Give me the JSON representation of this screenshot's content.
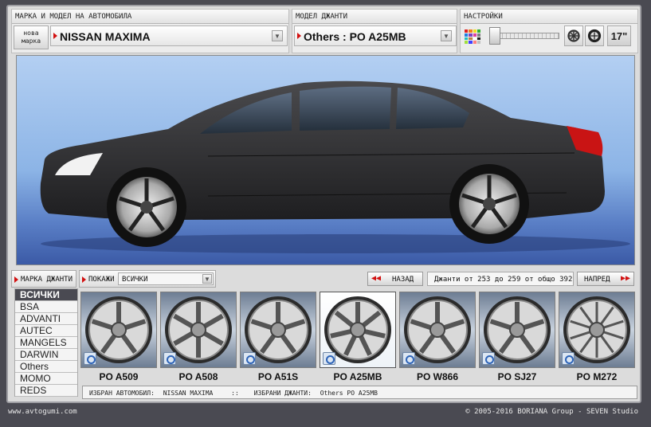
{
  "header": {
    "car_panel_title": "МАРКА И МОДЕЛ НА АВТОМОБИЛА",
    "new_brand_line1": "нова",
    "new_brand_line2": "марка",
    "car_selected": "NISSAN MAXIMA",
    "rims_panel_title": "МОДЕЛ ДЖАНТИ",
    "rim_selected": "Others : PO A25MB",
    "settings_title": "НАСТРОЙКИ",
    "rim_size": "17\""
  },
  "colors": {
    "accent_red": "#d21010",
    "palette": [
      "#e02020",
      "#f08020",
      "#f0e020",
      "#30b030",
      "#2080e0",
      "#8040c0",
      "#e040a0",
      "#808080",
      "#20c0c0",
      "#c08040",
      "#ffffff",
      "#202020",
      "#a0e040",
      "#4040ff",
      "#ff8080",
      "#c0c0c0"
    ]
  },
  "filters": {
    "brand_rims_label": "МАРКА ДЖАНТИ",
    "show_label": "ПОКАЖИ",
    "show_value": "ВСИЧКИ",
    "back_label": "НАЗАД",
    "range_info": "Джанти от 253 до 259 от общо 392",
    "next_label": "НАПРЕД"
  },
  "brands": [
    "ВСИЧКИ",
    "BSA",
    "ADVANTI",
    "AUTEC",
    "MANGELS",
    "DARWIN",
    "Others",
    "MOMO",
    "REDS"
  ],
  "active_brand_index": 0,
  "rims": [
    {
      "name": "PO A509",
      "spokes": 5
    },
    {
      "name": "PO A508",
      "spokes": 6
    },
    {
      "name": "PO A51S",
      "spokes": 5
    },
    {
      "name": "PO A25MB",
      "spokes": 7
    },
    {
      "name": "PO W866",
      "spokes": 5
    },
    {
      "name": "PO SJ27",
      "spokes": 5
    },
    {
      "name": "PO M272",
      "spokes": 10
    }
  ],
  "selected_rim_index": 3,
  "status": {
    "car_label": "ИЗБРАН АВТОМОБИЛ:",
    "car_value": "NISSAN MAXIMA",
    "separator": "::",
    "rims_label": "ИЗБРАНИ ДЖАНТИ:",
    "rims_value": "Others PO A25MB"
  },
  "footer": {
    "site": "www.avtogumi.com",
    "copyright": "© 2005-2016 BORIANA Group - SEVEN Studio"
  }
}
